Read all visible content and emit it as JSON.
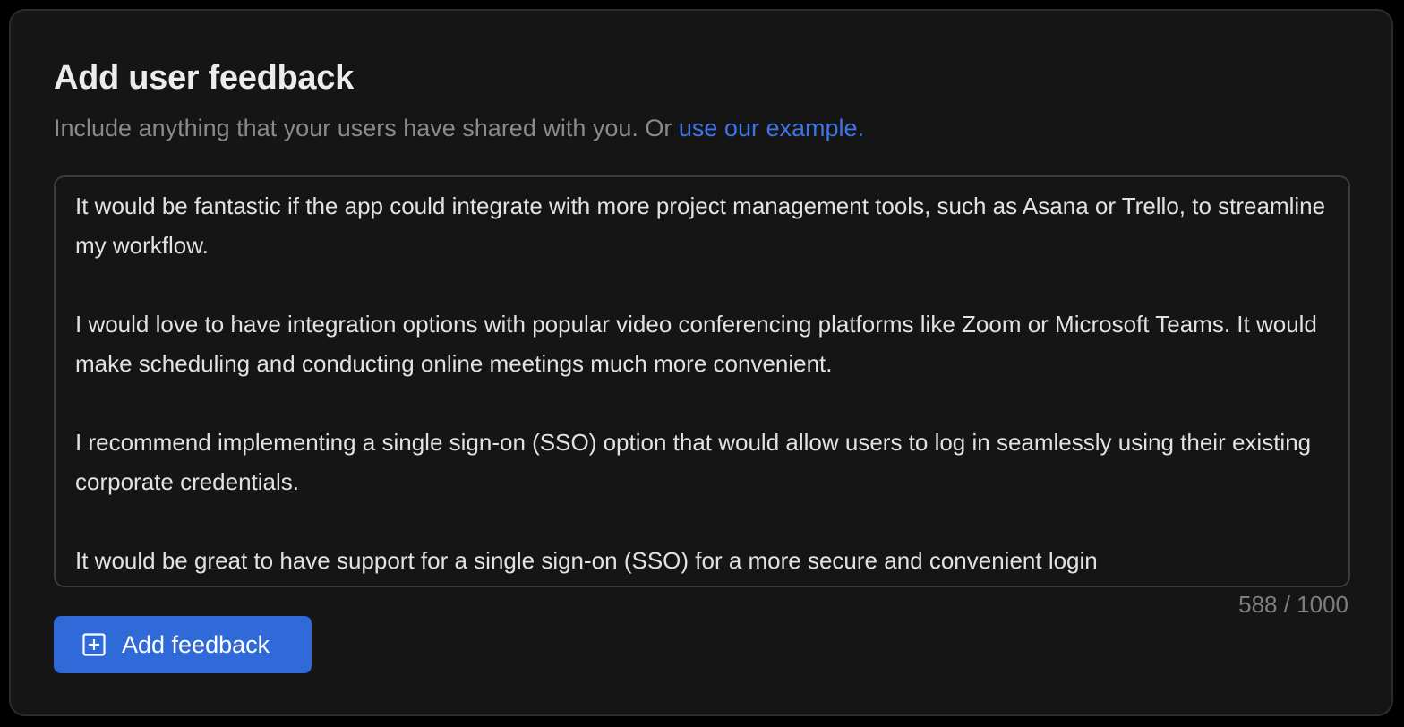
{
  "header": {
    "title": "Add user feedback",
    "subtitle": "Include anything that your users have shared with you. Or ",
    "example_link": "use our example."
  },
  "feedback": {
    "paragraphs": [
      "It would be fantastic if the app could integrate with more project management tools, such as Asana or Trello, to streamline my workflow.",
      "I would love to have integration options with popular video conferencing platforms like Zoom or Microsoft Teams. It would make scheduling and conducting online meetings much more convenient.",
      "I recommend implementing a single sign-on (SSO) option that would allow users to log in seamlessly using their existing corporate credentials.",
      "It would be great to have support for a single sign-on (SSO) for a more secure and convenient login"
    ],
    "char_count": "588 / 1000"
  },
  "actions": {
    "add_label": "Add feedback",
    "add_icon": "plus-square-icon"
  },
  "colors": {
    "background": "#151515",
    "accent": "#2f6ad8",
    "link": "#3d74e8"
  }
}
